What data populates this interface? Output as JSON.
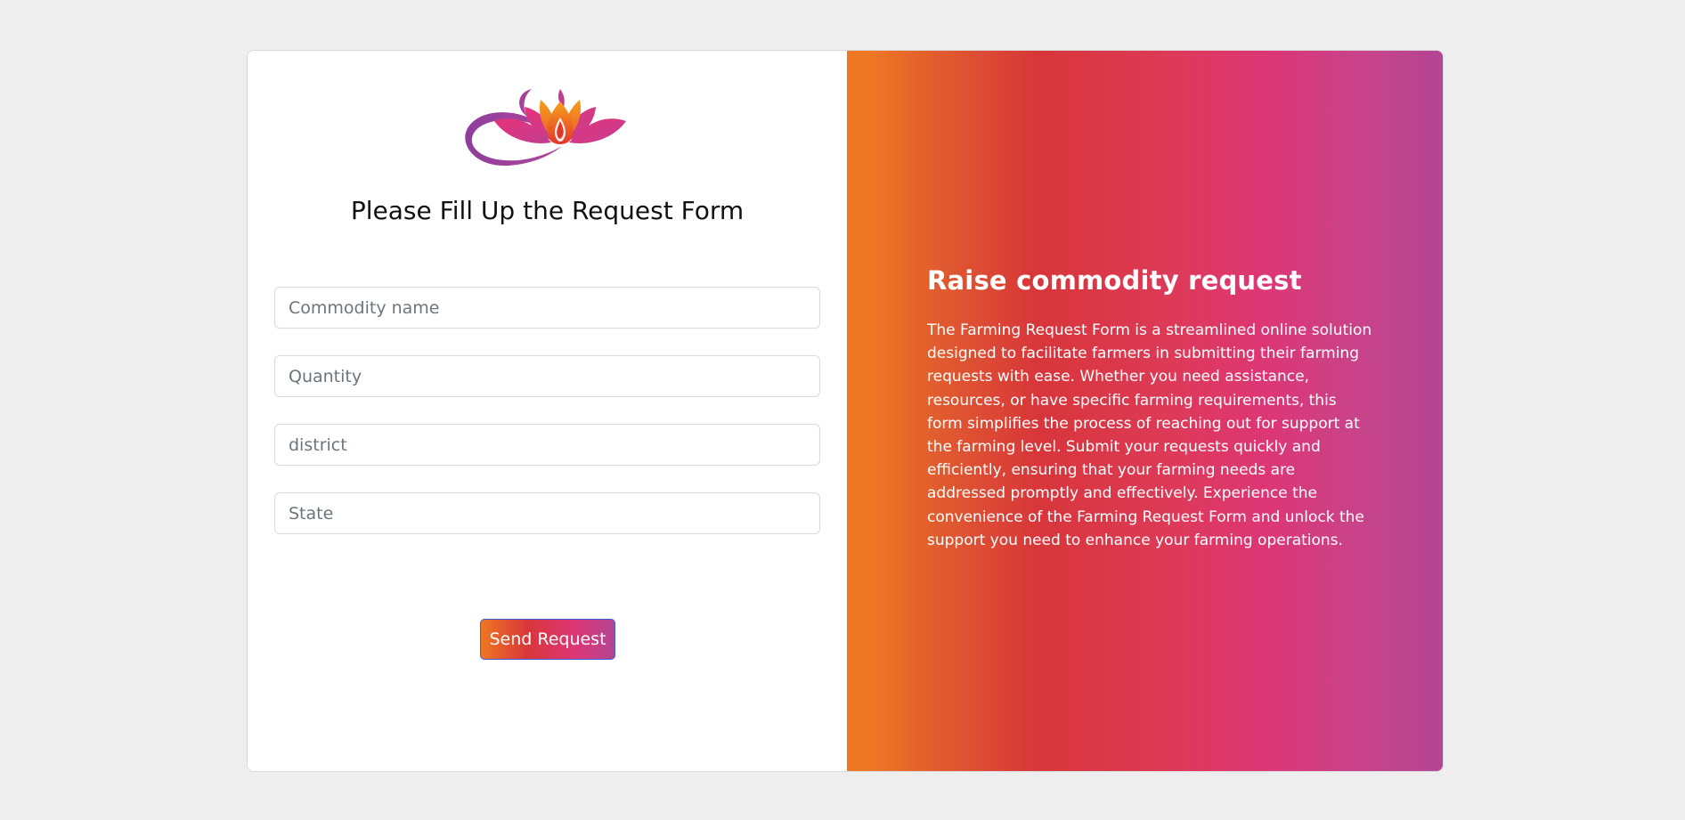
{
  "form": {
    "title": "Please Fill Up the Request Form",
    "fields": [
      {
        "name": "commodity",
        "placeholder": "Commodity name",
        "value": ""
      },
      {
        "name": "quantity",
        "placeholder": "Quantity",
        "value": ""
      },
      {
        "name": "district",
        "placeholder": "district",
        "value": ""
      },
      {
        "name": "state",
        "placeholder": "State",
        "value": ""
      }
    ],
    "submit_label": "Send Request"
  },
  "info": {
    "title": "Raise commodity request",
    "text": "The Farming Request Form is a streamlined online solution designed to facilitate farmers in submitting their farming requests with ease. Whether you need assistance, resources, or have specific farming requirements, this form simplifies the process of reaching out for support at the farming level. Submit your requests quickly and efficiently, ensuring that your farming needs are addressed promptly and effectively. Experience the convenience of the Farming Request Form and unlock the support you need to enhance your farming operations."
  },
  "logo": {
    "icon": "lotus-logo-icon"
  },
  "colors": {
    "page_bg": "#eeeeee",
    "gradient_start": "#ee7724",
    "gradient_mid1": "#d8363a",
    "gradient_mid2": "#dd3675",
    "gradient_end": "#b44593",
    "button_border": "#3b5bdb"
  }
}
